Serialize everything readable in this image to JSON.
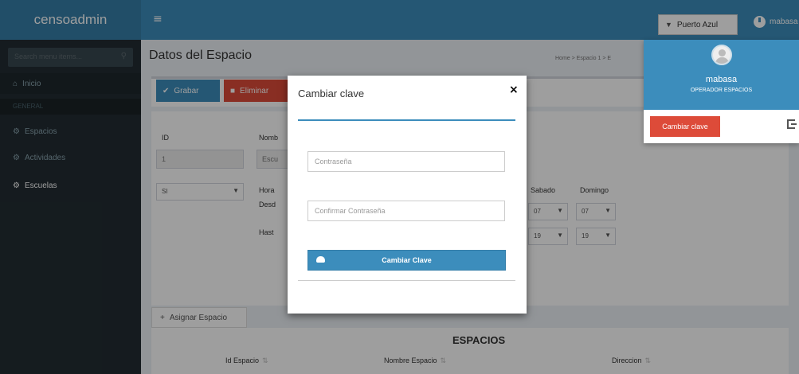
{
  "app": {
    "logo": "censoadmin",
    "menu_toggle": "≡"
  },
  "topbar": {
    "location": "Puerto Azul",
    "user": "mabasa"
  },
  "sidebar": {
    "search_placeholder": "Search menu items...",
    "items": [
      {
        "label": "Inicio",
        "icon": "home-icon"
      },
      {
        "label": "GENERAL",
        "icon": ""
      },
      {
        "label": "Espacios",
        "icon": "gear-icon"
      },
      {
        "label": "Actividades",
        "icon": "gear-icon"
      },
      {
        "label": "Escuelas",
        "icon": "gear-icon"
      }
    ]
  },
  "content": {
    "title": "Datos del Espacio",
    "breadcrumb": "Home > Espacio 1 > E",
    "btn_grabar": "Grabar",
    "btn_eliminar": "Eliminar",
    "form": {
      "id_label": "ID",
      "id_value": "1",
      "nombre_label": "Nomb",
      "nombre_value": "Escu",
      "select_value": "SI",
      "hora_label": "Hora",
      "desde_label": "Desd",
      "hasta_label": "Hast",
      "sabado_label": "Sabado",
      "domingo_label": "Domingo",
      "sab_desde": "07",
      "dom_desde": "07",
      "sab_hasta": "19",
      "dom_hasta": "19"
    },
    "tab_asignar": "Asignar Espacio",
    "table_title": "ESPACIOS",
    "columns": [
      "Id Espacio",
      "Nombre Espacio",
      "Direccion"
    ]
  },
  "modal": {
    "title": "Cambiar clave",
    "password_placeholder": "Contraseña",
    "confirm_placeholder": "Confirmar Contraseña",
    "submit": "Cambiar Clave"
  },
  "user_panel": {
    "name": "mabasa",
    "role": "OPERADOR ESPACIOS",
    "change_password": "Cambiar clave"
  },
  "colors": {
    "primary": "#3c8dbc",
    "danger": "#dd4b39",
    "sidebar": "#222d32"
  }
}
